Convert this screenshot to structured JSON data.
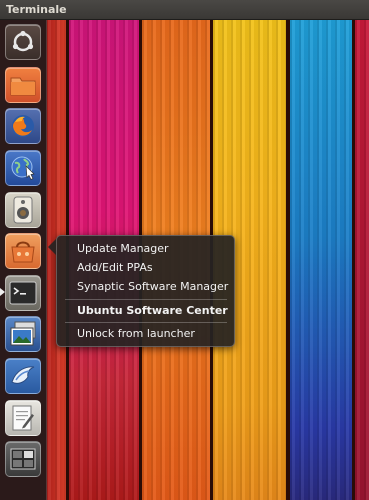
{
  "window": {
    "title": "Terminale"
  },
  "launcher": {
    "items": [
      {
        "icon": "ubuntu-logo-icon",
        "name": "Dash home"
      },
      {
        "icon": "folder-icon",
        "name": "Files"
      },
      {
        "icon": "firefox-icon",
        "name": "Firefox"
      },
      {
        "icon": "network-globe-icon",
        "name": "Network"
      },
      {
        "icon": "speaker-icon",
        "name": "Audio"
      },
      {
        "icon": "software-center-icon",
        "name": "Ubuntu Software Center"
      },
      {
        "icon": "terminal-icon",
        "name": "Terminal"
      },
      {
        "icon": "image-viewer-icon",
        "name": "Shotwell"
      },
      {
        "icon": "bird-icon",
        "name": "Thunderbird"
      },
      {
        "icon": "text-editor-icon",
        "name": "Text Editor"
      },
      {
        "icon": "workspace-switcher-icon",
        "name": "Workspaces"
      }
    ]
  },
  "quicklist": {
    "items": [
      {
        "label": "Update Manager",
        "bold": false
      },
      {
        "label": "Add/Edit PPAs",
        "bold": false
      },
      {
        "label": "Synaptic Software Manager",
        "bold": false
      },
      {
        "label": "Ubuntu Software Center",
        "bold": true
      },
      {
        "label": "Unlock from launcher",
        "bold": false
      }
    ]
  },
  "colors": {
    "panel_bg": "#3a3835",
    "launcher_bg": "#281e1e",
    "menu_bg": "#262422"
  }
}
